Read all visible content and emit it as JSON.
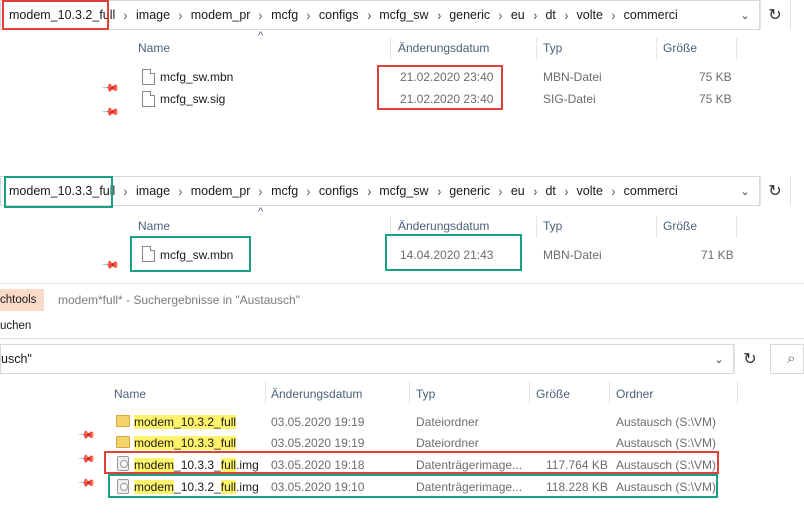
{
  "top_window": {
    "breadcrumbs": [
      "modem_10.3.2_full",
      "image",
      "modem_pr",
      "mcfg",
      "configs",
      "mcfg_sw",
      "generic",
      "eu",
      "dt",
      "volte",
      "commerci"
    ],
    "columns": [
      "Name",
      "Änderungsdatum",
      "Typ",
      "Größe"
    ],
    "sort_indicator": "^",
    "rows": [
      {
        "name": "mcfg_sw.mbn",
        "date": "21.02.2020 23:40",
        "type": "MBN-Datei",
        "size": "75 KB"
      },
      {
        "name": "mcfg_sw.sig",
        "date": "21.02.2020 23:40",
        "type": "SIG-Datei",
        "size": "75 KB"
      }
    ]
  },
  "mid_window": {
    "breadcrumbs": [
      "modem_10.3.3_full",
      "image",
      "modem_pr",
      "mcfg",
      "configs",
      "mcfg_sw",
      "generic",
      "eu",
      "dt",
      "volte",
      "commerci"
    ],
    "columns": [
      "Name",
      "Änderungsdatum",
      "Typ",
      "Größe"
    ],
    "sort_indicator": "^",
    "rows": [
      {
        "name": "mcfg_sw.mbn",
        "date": "14.04.2020 21:43",
        "type": "MBN-Datei",
        "size": "71 KB"
      }
    ]
  },
  "search_window": {
    "ribbon_tab_1": "chtools",
    "ribbon_tab_2": "uchen",
    "title": "modem*full* - Suchergebnisse in \"Austausch\"",
    "address": "usch\"",
    "columns": [
      "Name",
      "Änderungsdatum",
      "Typ",
      "Größe",
      "Ordner"
    ],
    "rows": [
      {
        "name_hl1": "modem",
        "name_mid": "_10.3.2_",
        "name_hl2": "full",
        "name_tail": "",
        "date": "03.05.2020 19:19",
        "type": "Dateiordner",
        "size": "",
        "folder": "Austausch (S:\\VM)"
      },
      {
        "name_hl1": "modem",
        "name_mid": "_10.3.3_",
        "name_hl2": "full",
        "name_tail": "",
        "date": "03.05.2020 19:19",
        "type": "Dateiordner",
        "size": "",
        "folder": "Austausch (S:\\VM)"
      },
      {
        "name_hl1": "modem",
        "name_mid": "_10.3.3_",
        "name_hl2": "full",
        "name_tail": ".img",
        "date": "03.05.2020 19:18",
        "type": "Datenträgerimage...",
        "size": "117.764 KB",
        "folder": "Austausch (S:\\VM)"
      },
      {
        "name_hl1": "modem",
        "name_mid": "_10.3.2_",
        "name_hl2": "full",
        "name_tail": ".img",
        "date": "03.05.2020 19:10",
        "type": "Datenträgerimage...",
        "size": "118.228 KB",
        "folder": "Austausch (S:\\VM)"
      }
    ]
  },
  "icons": {
    "chevron": "›",
    "dropdown": "⌄",
    "refresh": "↻",
    "pin": "✎",
    "search": "⌕"
  },
  "colors": {
    "annotation_red": "#e0403a",
    "annotation_green": "#16a086",
    "highlight": "#fff36b"
  }
}
